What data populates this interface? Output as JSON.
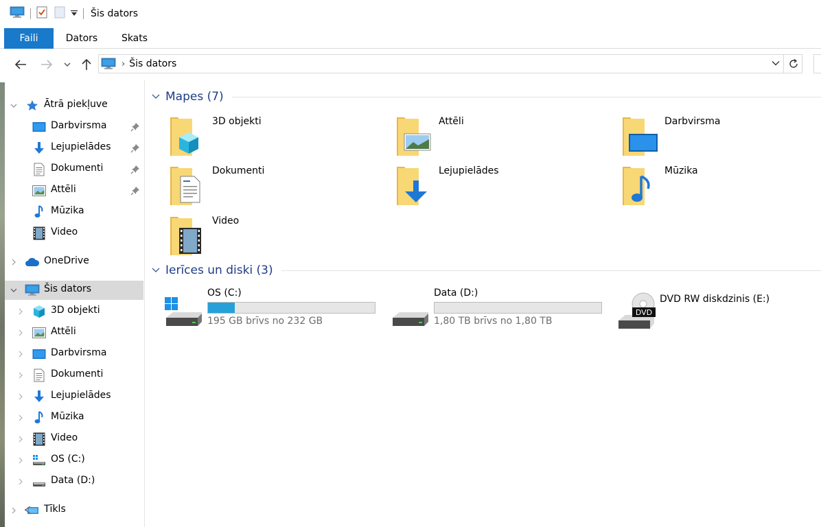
{
  "window": {
    "title": "Šis dators"
  },
  "ribbon": {
    "tabs": [
      "Faili",
      "Dators",
      "Skats"
    ]
  },
  "address": {
    "crumbs": [
      "Šis dators"
    ]
  },
  "nav": {
    "quick_access": "Ātrā piekļuve",
    "quick_items": [
      "Darbvirsma",
      "Lejupielādes",
      "Dokumenti",
      "Attēli",
      "Mūzika",
      "Video"
    ],
    "onedrive": "OneDrive",
    "this_pc": "Šis dators",
    "pc_items": [
      "3D objekti",
      "Attēli",
      "Darbvirsma",
      "Dokumenti",
      "Lejupielādes",
      "Mūzika",
      "Video",
      "OS (C:)",
      "Data (D:)"
    ],
    "network": "Tīkls"
  },
  "groups": {
    "folders_title": "Mapes (7)",
    "devices_title": "Ierīces un diski (3)"
  },
  "folders": [
    "3D objekti",
    "Attēli",
    "Darbvirsma",
    "Dokumenti",
    "Lejupielādes",
    "Mūzika",
    "Video"
  ],
  "drives": [
    {
      "name": "OS (C:)",
      "caption": "195 GB brīvs no 232 GB",
      "used_fraction": 0.16
    },
    {
      "name": "Data (D:)",
      "caption": "1,80 TB brīvs no 1,80 TB",
      "used_fraction": 0.0
    },
    {
      "name": "DVD RW diskdzinis (E:)"
    }
  ],
  "dvd_badge": "DVD",
  "colors": {
    "accent": "#1979ca",
    "group_title": "#1e3c87",
    "drive_fill": "#26a0da"
  }
}
